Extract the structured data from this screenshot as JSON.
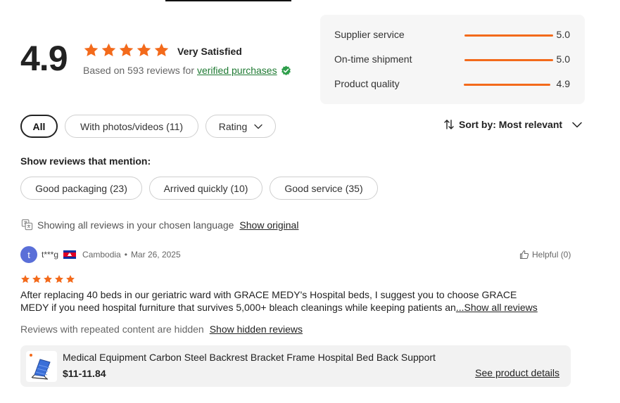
{
  "summary": {
    "score": "4.9",
    "stars": 5,
    "satisfaction_label": "Very Satisfied",
    "based_on": "Based on 593 reviews for",
    "verified_link": "verified purchases"
  },
  "ratings": [
    {
      "label": "Supplier service",
      "value": "5.0",
      "fill": 1.0
    },
    {
      "label": "On-time shipment",
      "value": "5.0",
      "fill": 1.0
    },
    {
      "label": "Product quality",
      "value": "4.9",
      "fill": 0.98
    }
  ],
  "filters": {
    "all": "All",
    "photos": "With photos/videos (11)",
    "rating": "Rating"
  },
  "sort": {
    "label": "Sort by: Most relevant"
  },
  "mentions": {
    "title": "Show reviews that mention:",
    "tags": [
      "Good packaging (23)",
      "Arrived quickly (10)",
      "Good service (35)"
    ]
  },
  "language": {
    "note": "Showing all reviews in your chosen language",
    "show_original": "Show original"
  },
  "review": {
    "avatar_letter": "t",
    "name": "t***g",
    "country": "Cambodia",
    "separator": "•",
    "date": "Mar 26, 2025",
    "helpful": "Helpful (0)",
    "stars": 5,
    "text_line1": "After replacing 40 beds in our geriatric ward with GRACE MEDY's Hospital beds,  I suggest you to choose GRACE",
    "text_line2": "MEDY if you need hospital furniture that survives 5,000+ bleach cleanings while keeping patients an",
    "show_all": "...Show all reviews"
  },
  "hidden": {
    "note": "Reviews with repeated content are hidden",
    "link": "Show hidden reviews"
  },
  "product": {
    "name": "Medical Equipment Carbon Steel Backrest Bracket Frame Hospital Bed Back Support",
    "price": "$11-11.84",
    "details_link": "See product details"
  },
  "colors": {
    "star": "#f36a1b",
    "verified": "#1f7a33",
    "bar": "#f36a1b"
  }
}
